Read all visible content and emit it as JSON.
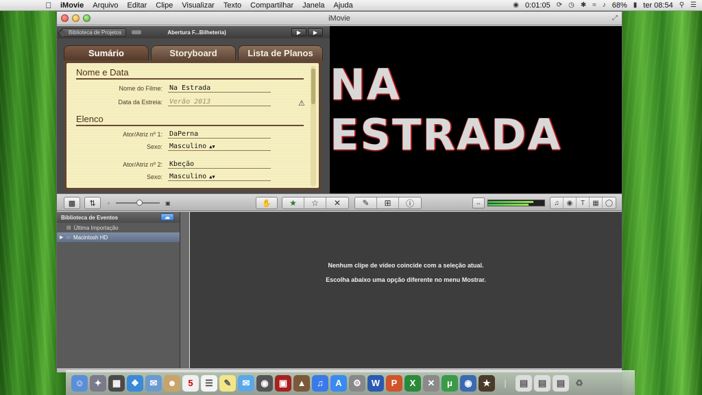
{
  "menubar": {
    "app_name": "iMovie",
    "items": [
      "Arquivo",
      "Editar",
      "Clipe",
      "Visualizar",
      "Texto",
      "Compartilhar",
      "Janela",
      "Ajuda"
    ],
    "clock_elapsed": "0:01:05",
    "battery": "68%",
    "datetime": "ter 08:54"
  },
  "window": {
    "title": "iMovie"
  },
  "project": {
    "library_button": "Biblioteca de Projetos",
    "title": "Abertura F...Bilheteria)"
  },
  "tabs": [
    "Sumário",
    "Storyboard",
    "Lista de Planos"
  ],
  "sections": {
    "name_date": "Nome e Data",
    "cast": "Elenco"
  },
  "fields": {
    "movie_name_label": "Nome do Filme:",
    "movie_name_value": "Na Estrada",
    "release_date_label": "Data da Estreia:",
    "release_date_value": "Verão 2013",
    "actor1_label": "Ator/Atriz nº 1:",
    "actor1_value": "DaPerna",
    "sex1_label": "Sexo:",
    "sex1_value": "Masculino",
    "actor2_label": "Ator/Atriz nº 2:",
    "actor2_value": "Kbeção",
    "sex2_label": "Sexo:",
    "sex2_value": "Masculino"
  },
  "preview": {
    "title_text": "NA ESTRADA"
  },
  "event_library": {
    "header": "Biblioteca de Eventos",
    "items": [
      "Última Importação",
      "Macintosh HD"
    ]
  },
  "clips": {
    "message_line1": "Nenhum clipe de vídeo coincide com a seleção atual.",
    "message_line2": "Escolha abaixo uma opção diferente no menu Mostrar."
  },
  "colors": {
    "tab_brown": "#5e4535",
    "paper": "#f6efc0",
    "title_red": "#b21818"
  }
}
